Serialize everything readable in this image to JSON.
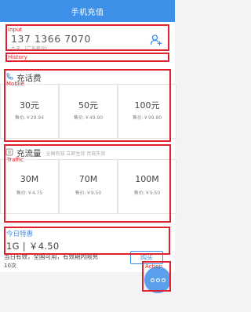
{
  "title": "手机充值",
  "phone": {
    "number": "137 1366 7070",
    "sub": "九子 （广东移动）"
  },
  "annotations": {
    "input": "Input",
    "history": "History",
    "mobile": "Mobile",
    "traffic": "Traffic",
    "action": "Action"
  },
  "mobile": {
    "title": "充话费",
    "cards": [
      {
        "amount": "30元",
        "price": "售价:￥29.94"
      },
      {
        "amount": "50元",
        "price": "售价:￥49.90"
      },
      {
        "amount": "100元",
        "price": "售价:￥99.80"
      }
    ]
  },
  "traffic": {
    "title": "充流量",
    "note": "全国有效 立即生效 月底失效",
    "cards": [
      {
        "amount": "30M",
        "price": "售价:￥4.75"
      },
      {
        "amount": "70M",
        "price": "售价:￥9.50"
      },
      {
        "amount": "100M",
        "price": "售价:￥9.50"
      }
    ]
  },
  "today": {
    "title": "今日特惠",
    "price": "1G | ￥4.50",
    "desc": "当日有效，全国可用，有效期内限充",
    "sub": "10次",
    "buy_label": "购买"
  },
  "colors": {
    "accent": "#3d8fe8",
    "annotation": "#e0202c"
  },
  "icons": {
    "contact": "add-contact-icon",
    "phone": "phone-icon",
    "traffic": "traffic-icon",
    "more": "more-icon"
  }
}
